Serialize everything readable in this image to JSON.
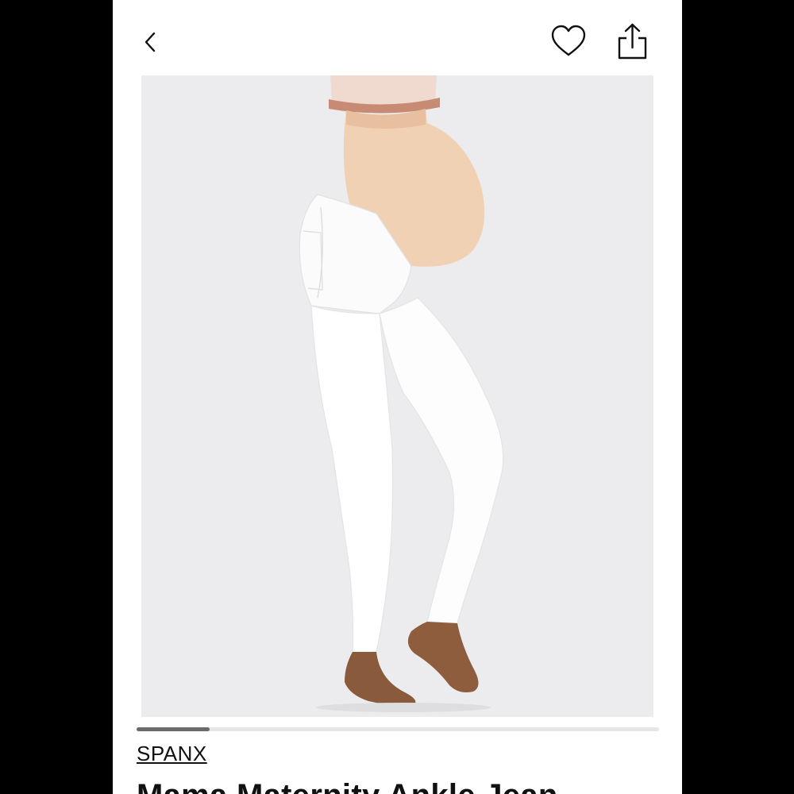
{
  "header": {
    "back_icon": "chevron-left-icon",
    "like_icon": "heart-outline-icon",
    "share_icon": "share-icon"
  },
  "gallery": {
    "image_subject": "model wearing white maternity ankle jeans",
    "progress": 0.14,
    "track_color": "#e6e6e6",
    "fill_color": "#6b6b6b",
    "background": "#ececee"
  },
  "product": {
    "brand": "SPANX",
    "title": "Mama Maternity Ankle Jean"
  }
}
